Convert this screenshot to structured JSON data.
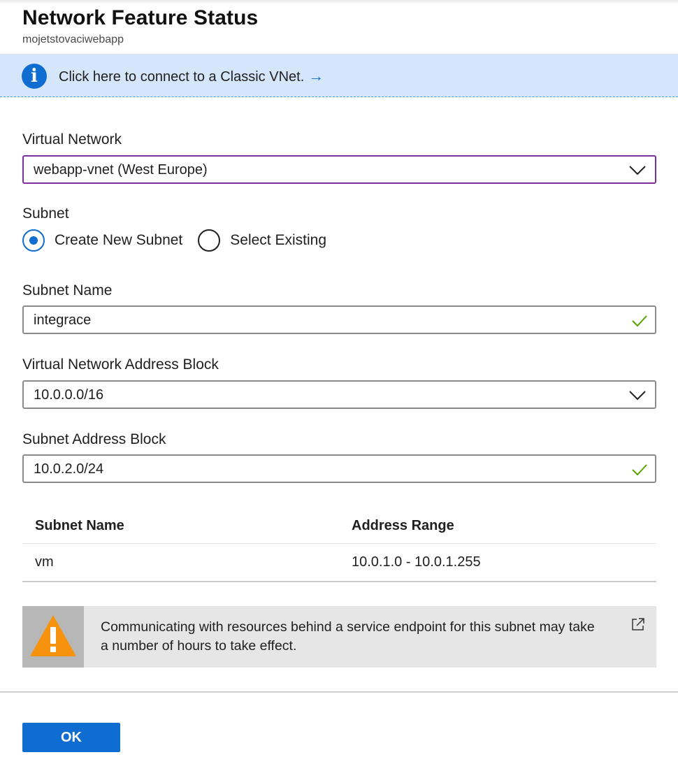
{
  "header": {
    "title": "Network Feature Status",
    "subtitle": "mojetstovaciwebapp"
  },
  "info_bar": {
    "text": "Click here to connect to a Classic VNet.",
    "arrow": "→",
    "icon": "info-icon"
  },
  "virtual_network": {
    "label": "Virtual Network",
    "value": "webapp-vnet (West Europe)"
  },
  "subnet": {
    "label": "Subnet",
    "options": [
      "Create New Subnet",
      "Select Existing"
    ],
    "selected": "Create New Subnet"
  },
  "subnet_name": {
    "label": "Subnet Name",
    "value": "integrace"
  },
  "vnet_address_block": {
    "label": "Virtual Network Address Block",
    "value": "10.0.0.0/16"
  },
  "subnet_address_block": {
    "label": "Subnet Address Block",
    "value": "10.0.2.0/24"
  },
  "subnets_table": {
    "columns": [
      "Subnet Name",
      "Address Range"
    ],
    "rows": [
      [
        "vm",
        "10.0.1.0 - 10.0.1.255"
      ]
    ]
  },
  "warning": {
    "text": "Communicating with resources behind a service endpoint for this subnet may take a number of hours to take effect.",
    "icon": "warning-icon",
    "link_icon": "external-link-icon"
  },
  "footer": {
    "ok_label": "OK"
  },
  "colors": {
    "accent": "#0f6cd1",
    "info_bg": "#d5e6fb",
    "focus_border": "#7a2f9c",
    "valid_check": "#57a300",
    "warning_orange": "#f7920f"
  }
}
